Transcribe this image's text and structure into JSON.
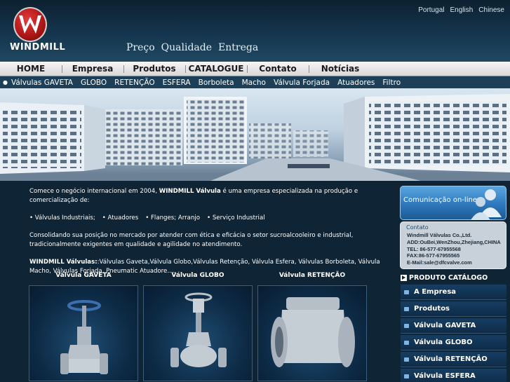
{
  "brand": {
    "name": "WINDMILL",
    "slogan": [
      "Preço",
      "Qualidade",
      "Entrega"
    ]
  },
  "languages": [
    "Portugal",
    "English",
    "Chinese"
  ],
  "nav": [
    "HOME",
    "Empresa",
    "Produtos",
    "CATALOGUE",
    "Contato",
    "Notícias"
  ],
  "subnav": [
    "Válvulas GAVETA",
    "GLOBO",
    "RETENÇÃO",
    "ESFERA",
    "Borboleta",
    "Macho",
    "Válvula Forjada",
    "Atuadores",
    "Filtro"
  ],
  "intro": {
    "p1_prefix": "Comece o negócio internacional em 2004, ",
    "p1_brand": "WINDMILL Válvula",
    "p1_suffix": " é uma empresa especializada na produção e comercialização de:",
    "features": [
      "• Válvulas Industriais;",
      "• Atuadores",
      "• Flanges; Arranjo",
      "• Serviço Industrial"
    ],
    "p2": "Consolidando sua posição no mercado por atender com ética e eficácia o setor sucroalcooleiro e industrial, tradicionalmente exigentes em qualidade e agilidade no atendimento.",
    "p3_brand": "WINDMILL Válvulas:",
    "p3_text": ":Válvulas Gaveta,Válvula Globo,Válvulas Retenção, Válvula Esfera, Válvulas Borboleta, Válvula Macho, Válvulas Forjada, Pneumatic Atuadore...."
  },
  "products": [
    {
      "title": "Válvula GAVETA",
      "icon": "gate-valve-image"
    },
    {
      "title": "Válvula GLOBO",
      "icon": "globe-valve-image"
    },
    {
      "title": "Válvula RETENÇÃO",
      "icon": "check-valve-image"
    }
  ],
  "sidebar": {
    "online_label": "Comunicação on-line",
    "contact_title": "Contato",
    "contact_lines": [
      "Windmill Válvulas Co.,Ltd.",
      "ADD:OuBei,WenZhou,Zhejiang,CHINA",
      "TEL: 86-577-67955568",
      "FAX:86-577-67955565",
      "E-Mail:sale@dfcvalve.com"
    ],
    "catalog_title": "PRODUTO CATÁLOGO",
    "catalog_items": [
      "A Empresa",
      "Produtos",
      "Válvula GAVETA",
      "Válvula GLOBO",
      "Válvula RETENÇÃO",
      "Válvula ESFERA"
    ]
  },
  "colors": {
    "background": "#0f2535",
    "nav_bg": "#e6e6e6",
    "subnav_bg": "#1d3f58",
    "logo_red": "#b01818",
    "online_blue": "#2e78bb"
  }
}
